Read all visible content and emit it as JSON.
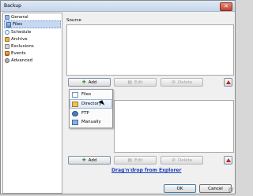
{
  "window": {
    "title": "Backup",
    "close_glyph": "✕"
  },
  "sidebar": {
    "items": [
      {
        "label": "General",
        "icon": "general-icon"
      },
      {
        "label": "Files",
        "icon": "files-icon",
        "selected": true
      },
      {
        "label": "Schedule",
        "icon": "schedule-icon"
      },
      {
        "label": "Archive",
        "icon": "archive-icon"
      },
      {
        "label": "Exclusions",
        "icon": "exclusions-icon"
      },
      {
        "label": "Events",
        "icon": "events-icon"
      },
      {
        "label": "Advanced",
        "icon": "advanced-icon"
      }
    ]
  },
  "source": {
    "label": "Source"
  },
  "toolbar_top": {
    "add": "Add",
    "edit": "Edit",
    "delete": "Delete"
  },
  "add_menu": {
    "items": [
      {
        "label": "Files",
        "icon": "file-icon"
      },
      {
        "label": "Directory",
        "icon": "folder-icon",
        "hovered": true
      },
      {
        "label": "FTP",
        "icon": "ftp-icon"
      },
      {
        "label": "Manually",
        "icon": "manual-icon"
      }
    ]
  },
  "toolbar_bottom": {
    "add": "Add",
    "edit": "Edit",
    "delete": "Delete"
  },
  "drag_drop_link": "Drag'n'drop from Explorer",
  "footer": {
    "ok": "OK",
    "cancel": "Cancel"
  }
}
